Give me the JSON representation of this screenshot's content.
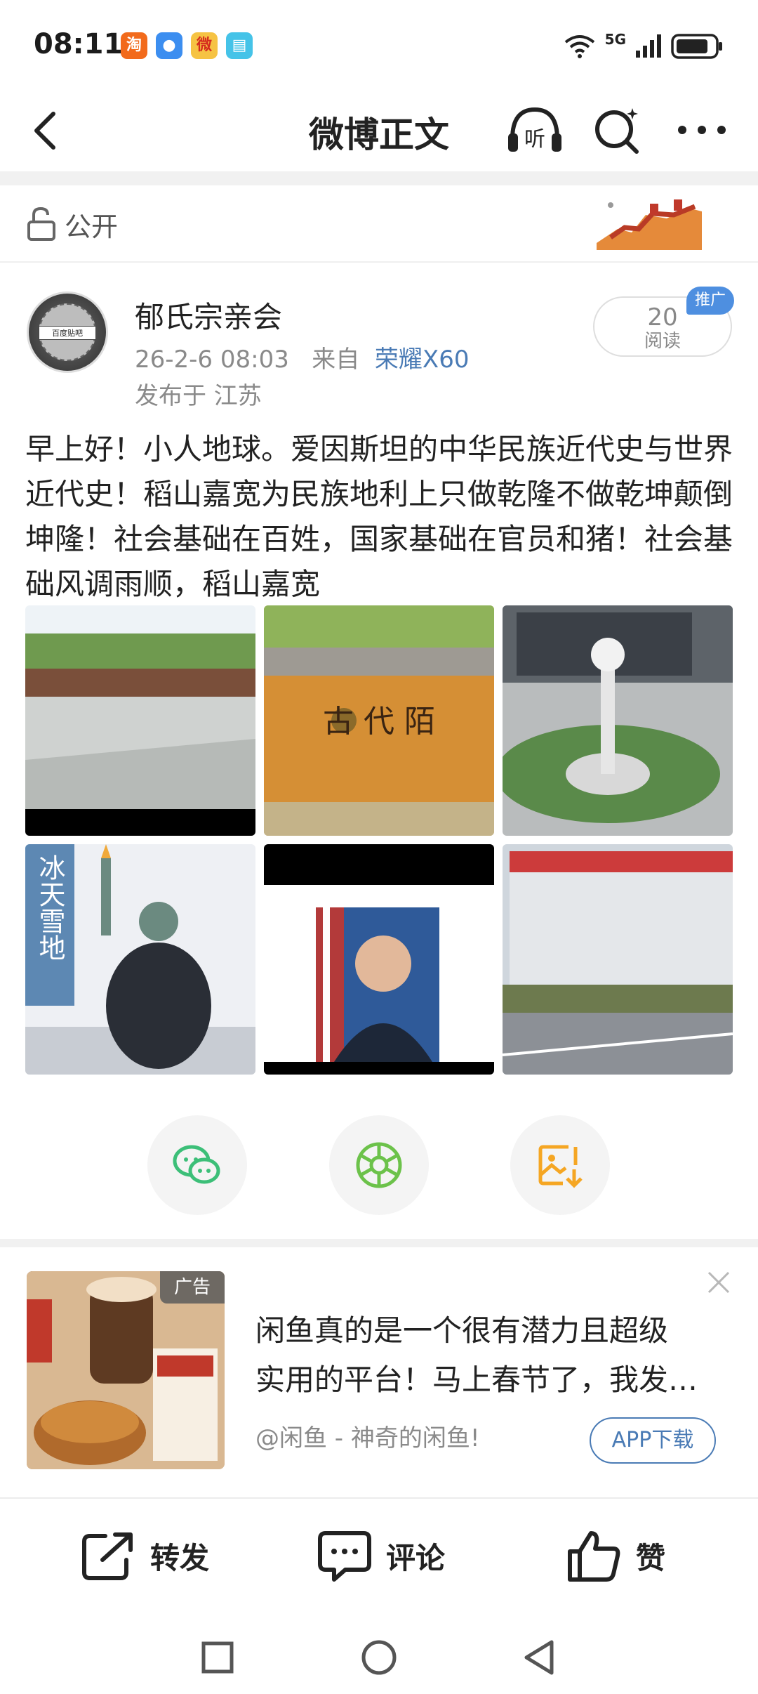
{
  "status_bar": {
    "time": "08:11",
    "network": "5G",
    "app_icons": [
      "taobao-app-icon",
      "message-app-icon",
      "weibo-app-icon",
      "reader-app-icon"
    ]
  },
  "nav": {
    "title": "微博正文",
    "listen_label": "听"
  },
  "visibility": {
    "label": "公开"
  },
  "post": {
    "author": "郁氏宗亲会",
    "date": "26-2-6 08:03",
    "from_label": "来自",
    "device": "荣耀X60",
    "location": "发布于 江苏",
    "reads": {
      "count": "20",
      "label": "阅读"
    },
    "promo_badge": "推广",
    "avatar_text": "百度贴吧",
    "text": "早上好！小人地球。爱因斯坦的中华民族近代史与世界近代史！稻山嘉宽为民族地利上只做乾隆不做乾坤颠倒坤隆！社会基础在百姓，国家基础在官员和猪！社会基础风调雨顺，稻山嘉宽",
    "images": [
      {
        "name": "photo-riverside-path"
      },
      {
        "name": "photo-ancient-wall",
        "text": "古  代  陌"
      },
      {
        "name": "photo-plaza-monument"
      },
      {
        "name": "photo-statue-snow",
        "text": "冰天雪地"
      },
      {
        "name": "photo-man-portrait"
      },
      {
        "name": "photo-factory-building"
      }
    ]
  },
  "share": [
    {
      "name": "wechat-share-button",
      "icon": "wechat-icon"
    },
    {
      "name": "moments-share-button",
      "icon": "moments-icon"
    },
    {
      "name": "save-image-button",
      "icon": "save-image-icon"
    }
  ],
  "ad": {
    "tag": "广告",
    "line1": "闲鱼真的是一个很有潜力且超级",
    "line2": "实用的平台！马上春节了，我发…",
    "source": "@闲鱼 - 神奇的闲鱼!",
    "download_label": "APP下载"
  },
  "actions": {
    "repost": "转发",
    "comment": "评论",
    "like": "赞"
  },
  "colors": {
    "accent_blue": "#4a7bb5",
    "promo_blue": "#4e8fe0",
    "wechat_green": "#3cbf78",
    "moments_green": "#6cc24a",
    "save_orange": "#f5a623"
  }
}
